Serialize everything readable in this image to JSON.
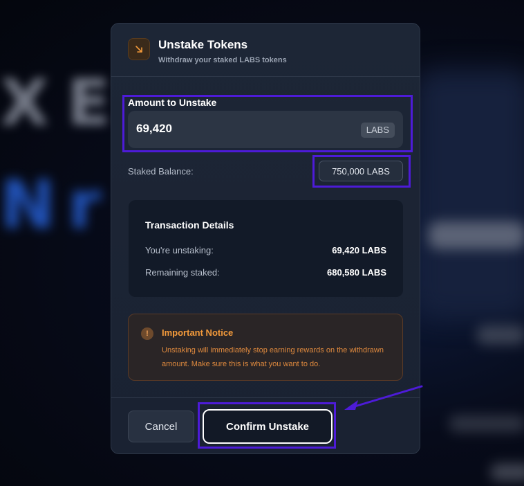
{
  "modal": {
    "title": "Unstake Tokens",
    "subtitle": "Withdraw your staked LABS tokens",
    "icon": "arrow-down-right-icon",
    "accent_color": "#f39a3b"
  },
  "amount": {
    "label": "Amount to Unstake",
    "value": "69,420",
    "unit": "LABS"
  },
  "balance": {
    "label": "Staked Balance:",
    "value": "750,000 LABS"
  },
  "details": {
    "title": "Transaction Details",
    "rows": [
      {
        "label": "You're unstaking:",
        "value": "69,420 LABS"
      },
      {
        "label": "Remaining staked:",
        "value": "680,580 LABS"
      }
    ]
  },
  "notice": {
    "icon": "exclamation-icon",
    "title": "Important Notice",
    "text": "Unstaking will immediately stop earning rewards on the withdrawn amount. Make sure this is what you want to do.",
    "color": "#f39a3b"
  },
  "footer": {
    "cancel_label": "Cancel",
    "confirm_label": "Confirm Unstake"
  },
  "annotations": {
    "highlight_color": "#4d1bd8"
  }
}
